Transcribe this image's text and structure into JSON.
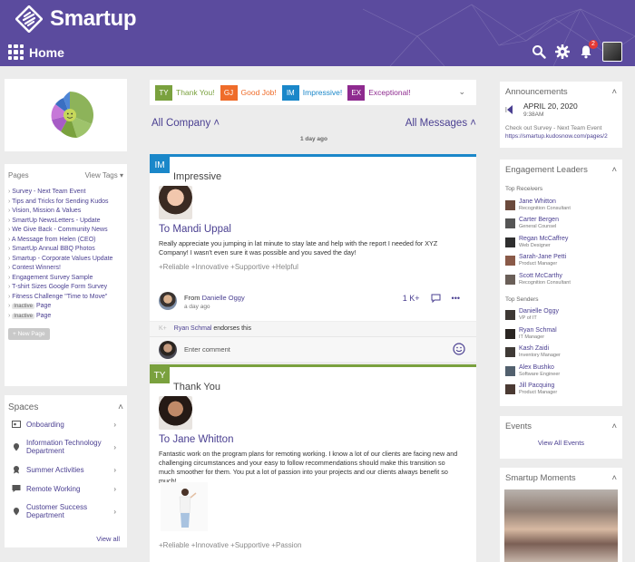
{
  "header": {
    "brand": "Smartup",
    "nav_title": "Home",
    "notification_count": "2"
  },
  "left": {
    "pages_title": "Pages",
    "view_tags_label": "View Tags",
    "pages": [
      "Survey - Next Team Event",
      "Tips and Tricks for Sending Kudos",
      "Vision, Mission & Values",
      "SmartUp NewsLetters - Update",
      "We Give Back - Community News",
      "A Message from Helen (CEO)",
      "SmartUp Annual BBQ Photos",
      "Smartup - Corporate Values Update",
      "Contest Winners!",
      "Engagement Survey Sample",
      "T-shirt Sizes Google Form Survey",
      "Fitness Challenge \"Time to Move\""
    ],
    "inactive_label": "Inactive",
    "inactive_pages": [
      "Page",
      "Page"
    ],
    "new_page_label": "+ New Page",
    "spaces_title": "Spaces",
    "spaces": [
      "Onboarding",
      "Information Technology Department",
      "Summer Activities",
      "Remote Working",
      "Customer Success Department"
    ],
    "view_all_label": "View all"
  },
  "kudos_types": [
    {
      "abbr": "TY",
      "label": "Thank You!",
      "color": "#7aa13e"
    },
    {
      "abbr": "GJ",
      "label": "Good Job!",
      "color": "#ef6c2a"
    },
    {
      "abbr": "IM",
      "label": "Impressive!",
      "color": "#1a87c9"
    },
    {
      "abbr": "EX",
      "label": "Exceptional!",
      "color": "#8e2a8f"
    }
  ],
  "feed": {
    "filter_company": "All Company",
    "filter_messages": "All Messages",
    "time_ago": "1 day ago",
    "posts": [
      {
        "tag": "IM",
        "type": "Impressive",
        "to_prefix": "To",
        "to": "Mandi Uppal",
        "message": "Really appreciate you jumping in lat minute to stay late and help with the report I needed for XYZ Company! I wasn't even sure it was possible and you saved the day!",
        "values": "+Reliable  +Innovative  +Supportive  +Helpful",
        "from_prefix": "From",
        "from": "Danielle Oggy",
        "time": "a day ago",
        "plus_count": "1 K+",
        "endorser": "Ryan Schmal",
        "endorse_text": "endorses this",
        "comment_placeholder": "Enter comment"
      },
      {
        "tag": "TY",
        "type": "Thank You",
        "to_prefix": "To",
        "to": "Jane Whitton",
        "message": "Fantastic work on the program plans for remoting working. I know a lot of our clients are facing new and challenging circumstances and your easy to follow recommendations should make this transition so much smoother for them. You put a lot of passion into your projects and our clients always benefit so much!",
        "values": "+Reliable  +Innovative  +Supportive  +Passion"
      }
    ]
  },
  "right": {
    "announcements_title": "Announcements",
    "ann_date": "APRIL 20, 2020",
    "ann_time": "9:38AM",
    "ann_text": "Check out Survey - Next Team Event",
    "ann_link": "https://smartup.kudosnow.com/pages/2",
    "leaders_title": "Engagement Leaders",
    "receivers_label": "Top Receivers",
    "receivers": [
      {
        "name": "Jane Whitton",
        "role": "Recognition Consultant"
      },
      {
        "name": "Carter Bergen",
        "role": "General Counsel"
      },
      {
        "name": "Regan McCaffrey",
        "role": "Web Designer"
      },
      {
        "name": "Sarah-Jane Petti",
        "role": "Product Manager"
      },
      {
        "name": "Scott McCarthy",
        "role": "Recognition Consultant"
      }
    ],
    "senders_label": "Top Senders",
    "senders": [
      {
        "name": "Danielle Oggy",
        "role": "VP of IT"
      },
      {
        "name": "Ryan Schmal",
        "role": "IT Manager"
      },
      {
        "name": "Kash Zaidi",
        "role": "Inventory Manager"
      },
      {
        "name": "Alex Bushko",
        "role": "Software Engineer"
      },
      {
        "name": "Jill Pacquing",
        "role": "Product Manager"
      }
    ],
    "events_title": "Events",
    "events_link": "View All Events",
    "moments_title": "Smartup Moments"
  },
  "colors": {
    "header": "#5b4b9e",
    "link": "#4a3f91",
    "impressive": "#1a87c9",
    "thank_you": "#7aa13e"
  }
}
